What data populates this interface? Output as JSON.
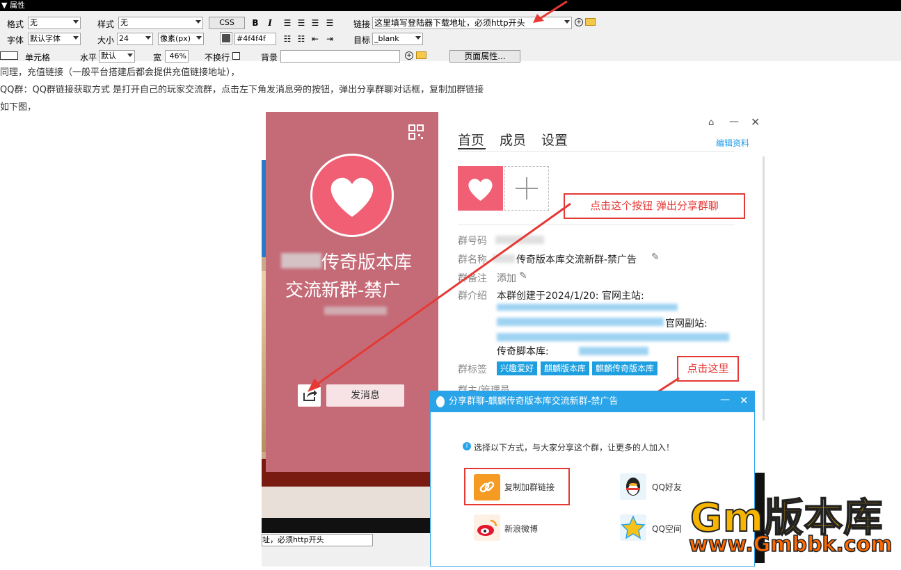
{
  "properties_panel": {
    "title": "属性",
    "format_label": "格式",
    "format_value": "无",
    "style_label": "样式",
    "style_value": "无",
    "css_button": "CSS",
    "bold": "B",
    "italic": "I",
    "link_label": "链接",
    "link_value": "这里填写登陆器下载地址，必须http开头",
    "font_label": "字体",
    "font_value": "默认字体",
    "size_label": "大小",
    "size_value": "24",
    "unit_value": "像素(px)",
    "color_value": "#4f4f4f",
    "target_label": "目标",
    "target_value": "_blank",
    "cell_label": "单元格",
    "horiz_label": "水平",
    "horiz_value": "默认",
    "width_label": "宽",
    "width_value": "46%",
    "nowrap_label": "不换行",
    "bg_label": "背景",
    "page_props_button": "页面属性...",
    "accent_color": "#000000"
  },
  "article": {
    "line1": "同理，充值链接（一般平台搭建后都会提供充值链接地址），",
    "line2": "QQ群：QQ群链接获取方式 是打开自己的玩家交流群，点击左下角发消息旁的按钮，弹出分享群聊对话框，复制加群链接",
    "line3": "如下图，"
  },
  "group_card": {
    "name_line1": "传奇版本库",
    "name_line2": "交流新群-禁广",
    "send_message": "发消息",
    "card_color": "#c56b78"
  },
  "group_info": {
    "tabs": [
      "首页",
      "成员",
      "设置"
    ],
    "edit_profile": "编辑资料",
    "callout_share": "点击这个按钮 弹出分享群聊",
    "group_number_label": "群号码",
    "group_name_label": "群名称",
    "group_name_value": "传奇版本库交流新群-禁广告",
    "group_remark_label": "群备注",
    "group_remark_value": "添加",
    "group_intro_label": "群介绍",
    "group_intro_line1": "本群创建于2024/1/20: 官网主站:",
    "group_intro_mirror": "官网副站:",
    "group_intro_script": "传奇脚本库:",
    "group_tags_label": "群标签",
    "tags": [
      "兴趣爱好",
      "麒麟版本库",
      "麒麟传奇版本库"
    ],
    "owner_label": "群主/管理员",
    "callout_here": "点击这里"
  },
  "share_dialog": {
    "title": "分享群聊-麒麟传奇版本库交流新群-禁广告",
    "hint": "选择以下方式，与大家分享这个群，让更多的人加入！",
    "copy_link": "复制加群链接",
    "qq_friends": "QQ好友",
    "weibo": "新浪微博",
    "qzone": "QQ空间",
    "accent_color": "#2aa4e8"
  },
  "watermark": {
    "line1": "Gm版本库",
    "line2": "www.Gmbbk.com"
  },
  "behind_fragment": {
    "link_text": "址，必须http开头"
  }
}
